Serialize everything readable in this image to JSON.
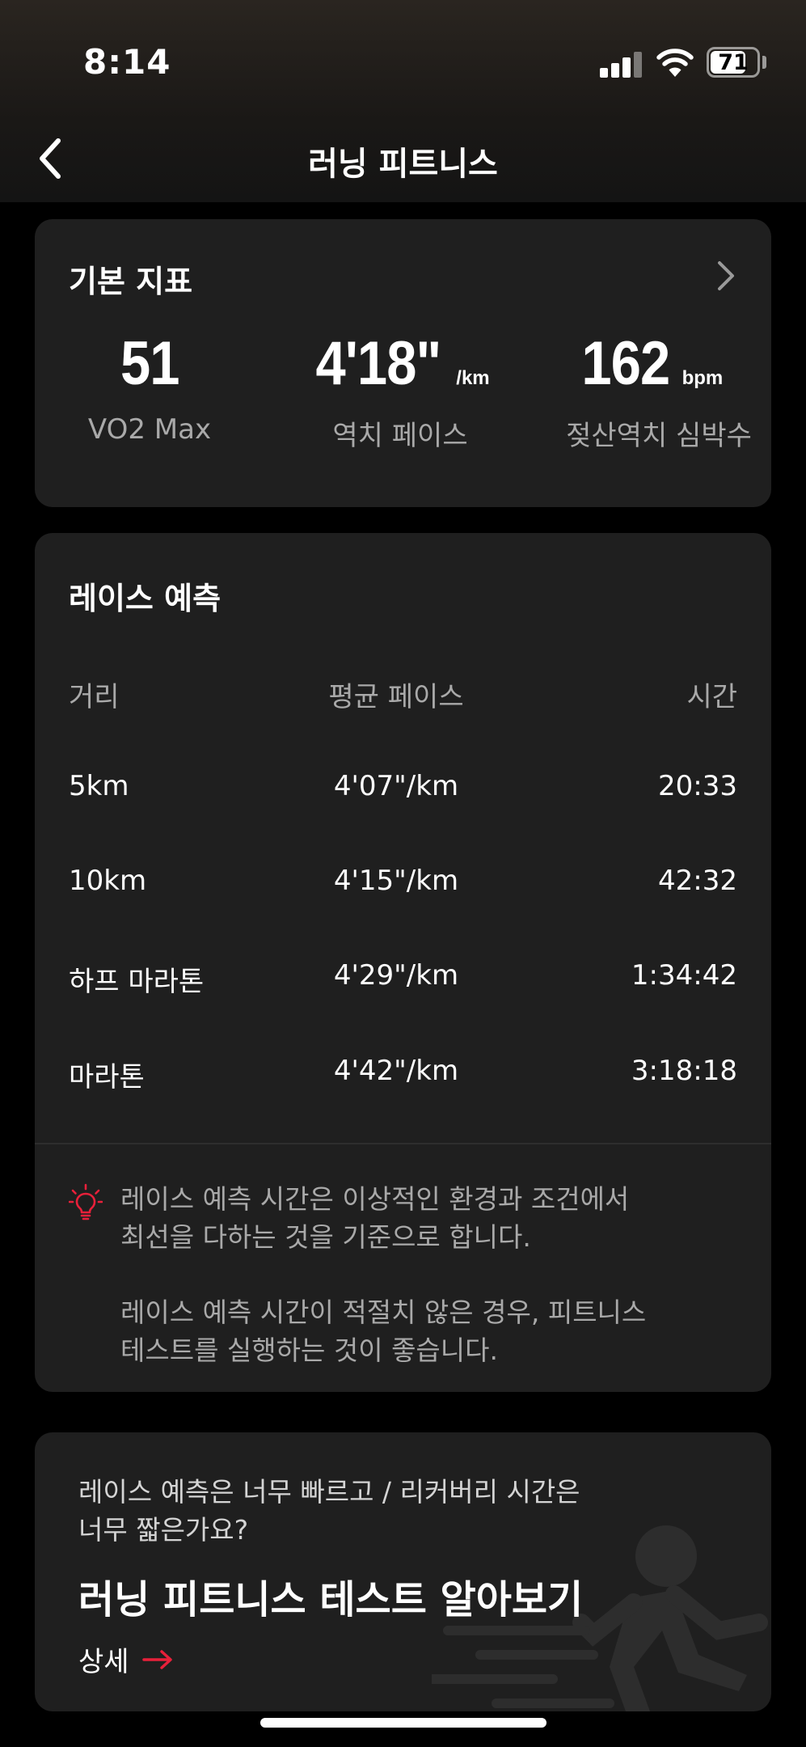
{
  "status_bar": {
    "time": "8:14",
    "battery_level": "71"
  },
  "nav": {
    "title": "러닝 피트니스"
  },
  "basic_metrics": {
    "title": "기본 지표",
    "items": [
      {
        "value": "51",
        "unit": "",
        "label": "VO2 Max"
      },
      {
        "value": "4'18\"",
        "unit": "/km",
        "label": "역치 페이스"
      },
      {
        "value": "162",
        "unit": "bpm",
        "label": "젖산역치 심박수"
      }
    ]
  },
  "race_prediction": {
    "title": "레이스 예측",
    "headers": {
      "distance": "거리",
      "pace": "평균 페이스",
      "time": "시간"
    },
    "rows": [
      {
        "distance": "5km",
        "pace": "4'07\"/km",
        "time": "20:33"
      },
      {
        "distance": "10km",
        "pace": "4'15\"/km",
        "time": "42:32"
      },
      {
        "distance": "하프 마라톤",
        "pace": "4'29\"/km",
        "time": "1:34:42"
      },
      {
        "distance": "마라톤",
        "pace": "4'42\"/km",
        "time": "3:18:18"
      }
    ],
    "tip_1_line1": "레이스 예측 시간은 이상적인 환경과 조건에서",
    "tip_1_line2": "최선을 다하는 것을 기준으로 합니다.",
    "tip_2_line1": "레이스 예측 시간이 적절치 않은 경우, 피트니스",
    "tip_2_line2": "테스트를 실행하는 것이 좋습니다."
  },
  "promo": {
    "question_line1": "레이스 예측은 너무 빠르고 / 리커버리 시간은",
    "question_line2": "너무 짧은가요?",
    "title": "러닝 피트니스 테스트 알아보기",
    "link_label": "상세"
  },
  "colors": {
    "background": "#000000",
    "card": "#1f1f1f",
    "accent_red": "#e8203a",
    "secondary_text": "#a9a9a9"
  },
  "icons": {
    "back": "chevron-left-icon",
    "detail": "chevron-right-icon",
    "tip": "lightbulb-icon",
    "link": "arrow-right-icon"
  }
}
